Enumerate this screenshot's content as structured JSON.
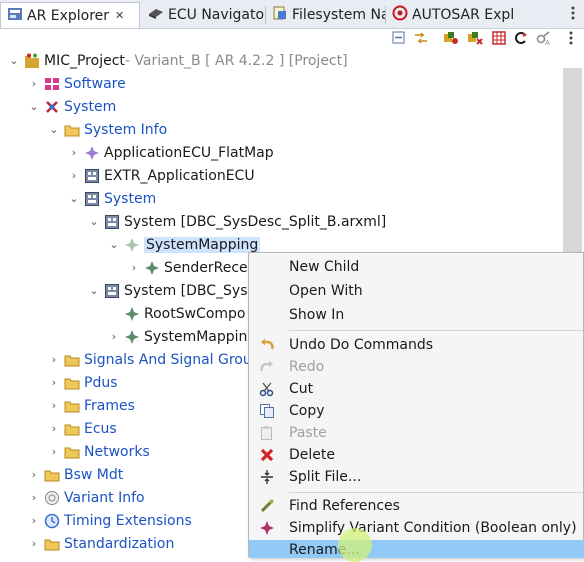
{
  "tabs": [
    {
      "label": "AR Explorer",
      "icon": "ar-explorer-icon",
      "active": true,
      "close": "✕"
    },
    {
      "label": "ECU Navigato",
      "icon": "ecu-navigator-icon",
      "active": false
    },
    {
      "label": "Filesystem Na",
      "icon": "filesystem-icon",
      "active": false
    },
    {
      "label": "AUTOSAR Expl",
      "icon": "autosar-explorer-icon",
      "active": false
    },
    {
      "label": "",
      "icon": "view-menu-icon",
      "active": false
    }
  ],
  "toolbar": [
    "collapse-all-icon",
    "link-with-editor-icon",
    "filter-icon",
    "variant-filter-icon",
    "grid-icon",
    "refresh-icon",
    "settings-icon",
    "view-menu-icon"
  ],
  "tree": {
    "project": {
      "label": "MIC_Project",
      "decoration": " - Variant_B [ AR 4.2.2 ] [Project]"
    },
    "rows": [
      {
        "label": "Software",
        "icon": "software-icon",
        "blue": true
      },
      {
        "label": "System",
        "icon": "system-icon",
        "blue": true
      },
      {
        "label": "System Info",
        "icon": "folder-icon",
        "blue": true
      },
      {
        "label": "ApplicationECU_FlatMap",
        "icon": "flatmap-icon",
        "blue": false
      },
      {
        "label": "EXTR_ApplicationECU",
        "icon": "system-element-icon",
        "blue": false
      },
      {
        "label": "System",
        "icon": "system-element-icon",
        "blue": true
      },
      {
        "label": "System [DBC_SysDesc_Split_B.arxml]",
        "icon": "system-element-icon",
        "blue": false
      },
      {
        "label": "SystemMapping",
        "icon": "mapping-icon",
        "blue": false,
        "selected": true
      },
      {
        "label": "SenderReceiv",
        "icon": "mapping-element-icon",
        "blue": false
      },
      {
        "label": "System [DBC_SysD",
        "icon": "system-element-icon",
        "blue": false
      },
      {
        "label": "RootSwCompo",
        "icon": "mapping-element-icon",
        "blue": false
      },
      {
        "label": "SystemMapping",
        "icon": "mapping-element-icon",
        "blue": false
      },
      {
        "label": "Signals And Signal Grou",
        "icon": "folder-icon",
        "blue": true
      },
      {
        "label": "Pdus",
        "icon": "folder-icon",
        "blue": true
      },
      {
        "label": "Frames",
        "icon": "folder-icon",
        "blue": true
      },
      {
        "label": "Ecus",
        "icon": "folder-icon",
        "blue": true
      },
      {
        "label": "Networks",
        "icon": "folder-icon",
        "blue": true
      },
      {
        "label": "Bsw Mdt",
        "icon": "folder-icon",
        "blue": true
      },
      {
        "label": "Variant Info",
        "icon": "variant-info-icon",
        "blue": true
      },
      {
        "label": "Timing Extensions",
        "icon": "clock-icon",
        "blue": true
      },
      {
        "label": "Standardization",
        "icon": "folder-icon",
        "blue": true
      }
    ]
  },
  "menu": {
    "items": [
      {
        "label": "New Child",
        "icon": "",
        "disabled": false
      },
      {
        "label": "Open With",
        "icon": "",
        "disabled": false
      },
      {
        "label": "Show In",
        "icon": "",
        "disabled": false
      },
      {
        "label": "Undo Do Commands",
        "icon": "undo-icon",
        "disabled": false
      },
      {
        "label": "Redo",
        "icon": "redo-icon",
        "disabled": true
      },
      {
        "label": "Cut",
        "icon": "cut-icon",
        "disabled": false
      },
      {
        "label": "Copy",
        "icon": "copy-icon",
        "disabled": false
      },
      {
        "label": "Paste",
        "icon": "paste-icon",
        "disabled": true
      },
      {
        "label": "Delete",
        "icon": "delete-icon",
        "disabled": false
      },
      {
        "label": "Split File...",
        "icon": "split-file-icon",
        "disabled": false
      },
      {
        "label": "Find References",
        "icon": "find-references-icon",
        "disabled": false
      },
      {
        "label": "Simplify Variant Condition (Boolean only)",
        "icon": "simplify-variant-icon",
        "disabled": false
      },
      {
        "label": "Rename...",
        "icon": "",
        "disabled": false,
        "highlighted": true
      }
    ]
  },
  "colors": {
    "link_blue": "#1b53c4",
    "decoration_gray": "#8a8a8a",
    "selection": "#cfe3ff",
    "menu_highlight": "#91c9f7"
  }
}
